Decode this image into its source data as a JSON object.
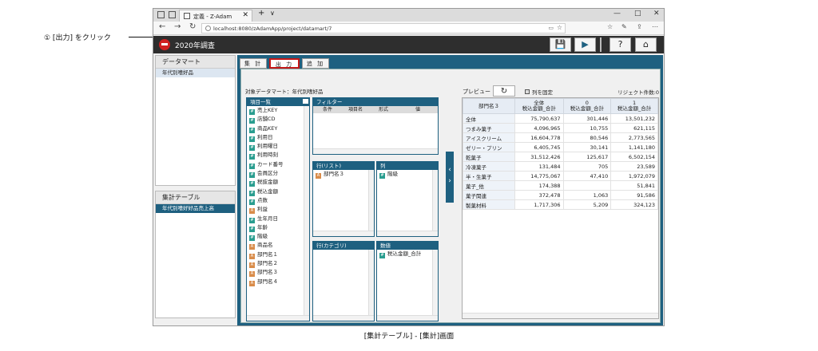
{
  "annotation": {
    "callout": "① [出力] をクリック",
    "caption": "[集計テーブル] - [集計]画面"
  },
  "browser": {
    "tab_title": "定義 - Z-Adam",
    "url": "localhost:8080/zAdamApp/project/datamart/7",
    "controls": {
      "minimize": "—",
      "maximize": "□",
      "close": "✕",
      "back": "←",
      "forward": "→",
      "reload": "↻",
      "new_tab": "+",
      "tab_menu": "∨"
    }
  },
  "app": {
    "title": "2020年調査",
    "buttons": {
      "save": "💾",
      "run": "▶",
      "help": "?",
      "home": "⌂"
    }
  },
  "sidebar": {
    "datamart": {
      "header": "データマート",
      "items": [
        "年代別嗜好品"
      ]
    },
    "table": {
      "header": "集計テーブル",
      "items": [
        "年代別嗜好好品売上高"
      ]
    }
  },
  "tabs": [
    "集 計",
    "出 力",
    "追 加"
  ],
  "target_label": "対象データマート：年代別嗜好品",
  "fields": {
    "header": "項目一覧",
    "items": [
      {
        "type": "N",
        "label": "売上KEY"
      },
      {
        "type": "N",
        "label": "店舗CD"
      },
      {
        "type": "N",
        "label": "商品KEY"
      },
      {
        "type": "N",
        "label": "利用日"
      },
      {
        "type": "N",
        "label": "利用曜日"
      },
      {
        "type": "N",
        "label": "利用時刻"
      },
      {
        "type": "N",
        "label": "カード番号"
      },
      {
        "type": "N",
        "label": "会員区分"
      },
      {
        "type": "N",
        "label": "税抜金額"
      },
      {
        "type": "N",
        "label": "税込金額"
      },
      {
        "type": "N",
        "label": "点数"
      },
      {
        "type": "A",
        "label": "利益"
      },
      {
        "type": "N",
        "label": "生年月日"
      },
      {
        "type": "N",
        "label": "年齢"
      },
      {
        "type": "N",
        "label": "階級"
      },
      {
        "type": "A",
        "label": "商品名"
      },
      {
        "type": "A",
        "label": "部門名１"
      },
      {
        "type": "A",
        "label": "部門名２"
      },
      {
        "type": "A",
        "label": "部門名３"
      },
      {
        "type": "A",
        "label": "部門名４"
      }
    ]
  },
  "filter": {
    "header": "フィルター",
    "columns": [
      "条件",
      "項目名",
      "形式",
      "値"
    ]
  },
  "rows_list": {
    "header": "行(リスト)",
    "items": [
      {
        "type": "A",
        "label": "部門名３"
      }
    ]
  },
  "cols": {
    "header": "列",
    "items": [
      {
        "type": "N",
        "label": "階級"
      }
    ]
  },
  "rows_cat": {
    "header": "行(カテゴリ)",
    "items": []
  },
  "values": {
    "header": "数値",
    "items": [
      {
        "type": "N",
        "label": "税込金額_合計"
      }
    ]
  },
  "preview": {
    "label": "プレビュー",
    "fix_columns": "列を固定",
    "reject": "リジェクト件数:0",
    "headers": [
      [
        "部門名３"
      ],
      [
        "全体",
        "税込金額_合計"
      ],
      [
        "0",
        "税込金額_合計"
      ],
      [
        "1",
        "税込金額_合計"
      ]
    ],
    "rows": [
      [
        "全体",
        "75,790,637",
        "301,446",
        "13,501,232"
      ],
      [
        "つまみ菓子",
        "4,096,965",
        "10,755",
        "621,115"
      ],
      [
        "アイスクリーム",
        "16,604,778",
        "80,546",
        "2,773,565"
      ],
      [
        "ゼリー・プリン",
        "6,405,745",
        "30,141",
        "1,141,180"
      ],
      [
        "乾菓子",
        "31,512,426",
        "125,617",
        "6,502,154"
      ],
      [
        "冷凍菓子",
        "131,484",
        "705",
        "23,589"
      ],
      [
        "半・生菓子",
        "14,775,067",
        "47,410",
        "1,972,079"
      ],
      [
        "菓子_他",
        "174,388",
        "",
        "51,841"
      ],
      [
        "菓子関連",
        "372,478",
        "1,063",
        "91,586"
      ],
      [
        "製菓材料",
        "1,717,306",
        "5,209",
        "324,123"
      ]
    ]
  }
}
